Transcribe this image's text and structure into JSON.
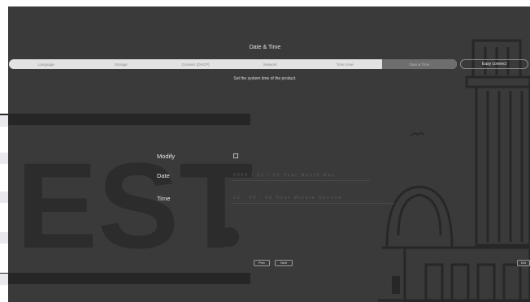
{
  "header": {
    "title": "Date & Time"
  },
  "steps": [
    {
      "label": "Language"
    },
    {
      "label": "Storage"
    },
    {
      "label": "Connect (DHCP)"
    },
    {
      "label": "Network"
    },
    {
      "label": "Time zone"
    },
    {
      "label": "Date & Time"
    }
  ],
  "current_step_index": 5,
  "easy_connect": {
    "label": "Easy connect"
  },
  "subtitle": "Set the system time of the product.",
  "form": {
    "modify": {
      "label": "Modify",
      "checked": false
    },
    "date": {
      "label": "Date",
      "value": "2024 / 01 / 01   Year   Month   Day"
    },
    "time": {
      "label": "Time",
      "value": "12 : 00 : 00   Hour   Minute   Second"
    }
  },
  "buttons": {
    "prev": "Prev",
    "next": "Next",
    "exit": "Exit"
  },
  "colors": {
    "background": "#3a3a3a",
    "art": "#2a2a2a",
    "progress_track": "#e2e2e2",
    "progress_current": "#6e6e6e"
  }
}
